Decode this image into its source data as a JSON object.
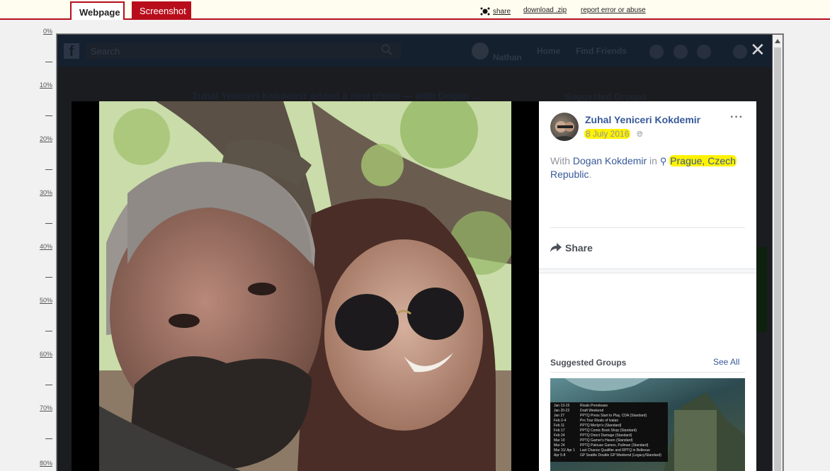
{
  "tabs": [
    {
      "label": "Webpage",
      "active": true
    },
    {
      "label": "Screenshot",
      "active": false
    }
  ],
  "top_links": {
    "share": "share",
    "download": "download .zip",
    "report": "report error or abuse"
  },
  "ruler": [
    "0%",
    "10%",
    "20%",
    "30%",
    "40%",
    "50%",
    "60%",
    "70%",
    "80%"
  ],
  "fb": {
    "search_placeholder": "Search",
    "user_name": "Nathan",
    "nav": [
      "Home",
      "Find Friends"
    ],
    "bg_post": "Zuhal Yeniceri Kokdemir added a new photo — with Dogan ...",
    "bg_suggested": "Suggested Groups"
  },
  "post": {
    "author": "Zuhal Yeniceri Kokdemir",
    "date": "8 July 2016",
    "with_prefix": "With ",
    "with_person": "Dogan Kokdemir",
    "in_text": " in ",
    "location": "Prague, Czech",
    "location_rest": "Republic",
    "period": ".",
    "share_label": "Share",
    "more": "···"
  },
  "suggested": {
    "title": "Suggested Groups",
    "see_all": "See All",
    "schedule": [
      {
        "date": "Jan 13-15",
        "event": "Rivals Prerelease"
      },
      {
        "date": "Jan 20-22",
        "event": "Draft Weekend"
      },
      {
        "date": "Jan 27",
        "event": "PPTQ Press Start to Play, CDA (Standard)"
      },
      {
        "date": "Feb 2-4",
        "event": "Pro Tour Rivals of Ixalan"
      },
      {
        "date": "Feb 11",
        "event": "PPTQ Merlyn's (Standard)"
      },
      {
        "date": "Feb 17",
        "event": "PPTQ Comic Book Shop (Standard)"
      },
      {
        "date": "Feb 24",
        "event": "PPTQ Direct Damage (Standard)"
      },
      {
        "date": "Mar 10",
        "event": "PPTQ Gamer's Haven (Standard)"
      },
      {
        "date": "Mar 24",
        "event": "PPTQ Palouse Games, Pullman (Standard)"
      },
      {
        "date": "Mar 31/ Apr 1",
        "event": "Last Chance Qualifier and RPTQ in Bellevue"
      },
      {
        "date": "Apr 5-8",
        "event": "GP Seattle Double GP Weekend (Legacy/Standard)"
      }
    ]
  },
  "colors": {
    "accent_red": "#b80e1c",
    "fb_link": "#365899",
    "highlight": "#fff200"
  }
}
